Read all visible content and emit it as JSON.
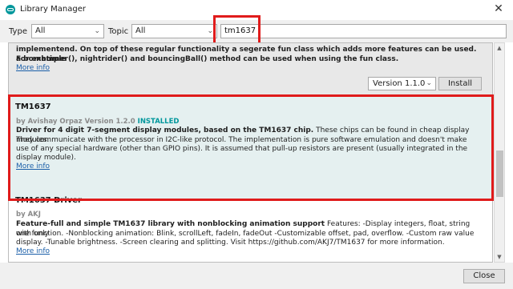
{
  "window": {
    "title": "Library Manager",
    "close_glyph": "✕"
  },
  "filters": {
    "type_label": "Type",
    "type_value": "All",
    "topic_label": "Topic",
    "topic_value": "All",
    "search_value": "tm1637"
  },
  "libraries": [
    {
      "partial_text_1": "implementend. On top of these regular functionality a segerate fun class which adds more features can be used. For example",
      "partial_text_2": "a bombtimer(), nightrider() and bouncingBall() method can be used when using the fun class.",
      "more_info": "More info",
      "version_select": "Version 1.1.0",
      "install_label": "Install"
    },
    {
      "name": "TM1637",
      "by_prefix": "by",
      "author": "Avishay Orpaz",
      "version_prefix": "Version",
      "version": "1.2.0",
      "status": "INSTALLED",
      "sentence_bold": "Driver for 4 digit 7-segment display modules, based on the TM1637 chip.",
      "sentence_rest_1": "These chips can be found in cheap display modules.",
      "line_2": "They communicate with the processor in I2C-like protocol. The implementation is pure software emulation and doesn't make",
      "line_3": "use of any special hardware (other than GPIO pins). It is assumed that pull-up resistors are present (usually integrated in the",
      "line_4": "display module).",
      "more_info": "More info"
    },
    {
      "name": "TM1637 Driver",
      "by_line": "by AKJ",
      "sentence_bold": "Feature-full and simple TM1637 library with nonblocking animation support",
      "sentence_rest_1": "Features: -Display integers, float, string with only",
      "line_2": "one function. -Nonblocking animation: Blink, scrollLeft, fadeIn, fadeOut -Customizable offset, pad, overflow. -Custom raw value",
      "line_3": "display. -Tunable brightness. -Screen clearing and splitting. Visit https://github.com/AKJ7/TM1637 for more information.",
      "more_info": "More info"
    }
  ],
  "footer": {
    "close_label": "Close"
  },
  "icons": {
    "app": "arduino-logo-icon",
    "chevron": "chevron-down-icon",
    "scroll_up": "▲",
    "scroll_down": "▼"
  },
  "colors": {
    "highlight": "#e01b1b",
    "link": "#1a5ea8",
    "installed": "#00979c",
    "selected_bg": "#e5f0f0"
  }
}
